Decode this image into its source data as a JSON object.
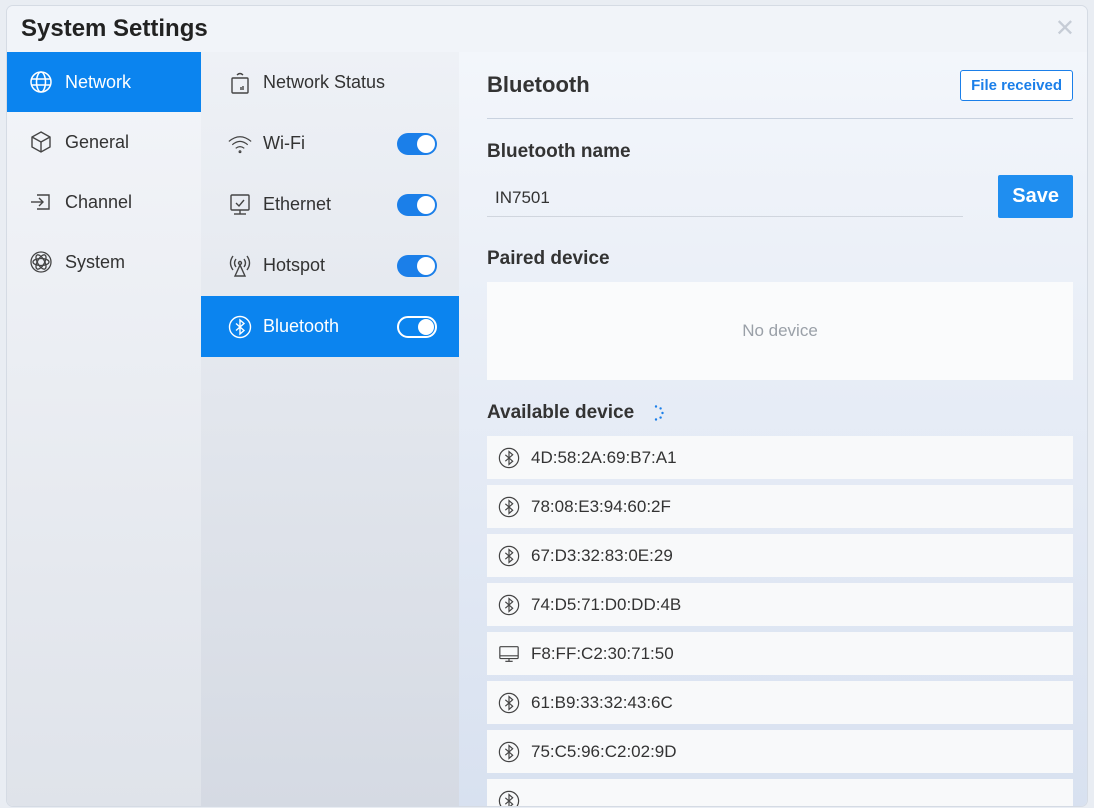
{
  "window": {
    "title": "System Settings"
  },
  "nav": [
    {
      "label": "Network",
      "icon": "globe-icon",
      "active": true
    },
    {
      "label": "General",
      "icon": "cube-icon",
      "active": false
    },
    {
      "label": "Channel",
      "icon": "input-icon",
      "active": false
    },
    {
      "label": "System",
      "icon": "atom-icon",
      "active": false
    }
  ],
  "subnav": [
    {
      "label": "Network Status",
      "icon": "router-icon",
      "toggle": null
    },
    {
      "label": "Wi-Fi",
      "icon": "wifi-icon",
      "toggle": true
    },
    {
      "label": "Ethernet",
      "icon": "ethernet-icon",
      "toggle": true
    },
    {
      "label": "Hotspot",
      "icon": "hotspot-icon",
      "toggle": true
    },
    {
      "label": "Bluetooth",
      "icon": "bluetooth-icon",
      "toggle": true,
      "active": true
    }
  ],
  "bluetooth": {
    "title": "Bluetooth",
    "file_received": "File received",
    "name_label": "Bluetooth name",
    "name_value": "IN7501",
    "save_label": "Save",
    "paired_label": "Paired device",
    "paired_empty": "No device",
    "available_label": "Available device",
    "devices": [
      {
        "mac": "4D:58:2A:69:B7:A1",
        "icon": "bluetooth-icon"
      },
      {
        "mac": "78:08:E3:94:60:2F",
        "icon": "bluetooth-icon"
      },
      {
        "mac": "67:D3:32:83:0E:29",
        "icon": "bluetooth-icon"
      },
      {
        "mac": "74:D5:71:D0:DD:4B",
        "icon": "bluetooth-icon"
      },
      {
        "mac": "F8:FF:C2:30:71:50",
        "icon": "monitor-icon"
      },
      {
        "mac": "61:B9:33:32:43:6C",
        "icon": "bluetooth-icon"
      },
      {
        "mac": "75:C5:96:C2:02:9D",
        "icon": "bluetooth-icon"
      }
    ]
  },
  "colors": {
    "accent": "#0b84ef",
    "toggle_on": "#1b7fe9"
  }
}
